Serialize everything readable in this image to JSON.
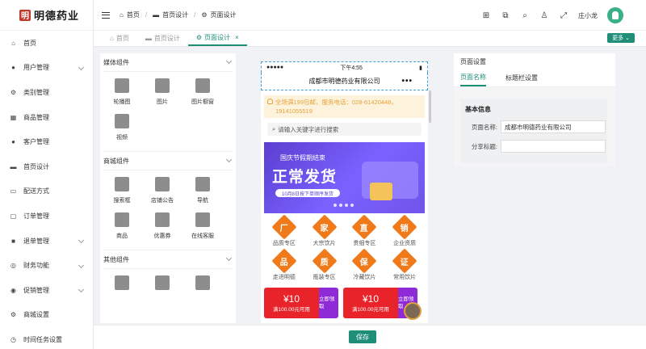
{
  "brand": {
    "name": "明德药业",
    "mark": "明"
  },
  "sidebar": {
    "items": [
      {
        "label": "首页",
        "icon": "home-icon",
        "glyph": "⌂",
        "chevron": false
      },
      {
        "label": "用户管理",
        "icon": "user-icon",
        "glyph": "●",
        "chevron": true
      },
      {
        "label": "类别管理",
        "icon": "category-icon",
        "glyph": "⚙",
        "chevron": false
      },
      {
        "label": "商品管理",
        "icon": "grid-icon",
        "glyph": "▦",
        "chevron": false
      },
      {
        "label": "客户管理",
        "icon": "customer-icon",
        "glyph": "●",
        "chevron": false
      },
      {
        "label": "首页设计",
        "icon": "monitor-icon",
        "glyph": "▬",
        "chevron": false
      },
      {
        "label": "配送方式",
        "icon": "truck-icon",
        "glyph": "▭",
        "chevron": false
      },
      {
        "label": "订单管理",
        "icon": "order-icon",
        "glyph": "▢",
        "chevron": false
      },
      {
        "label": "退单管理",
        "icon": "return-icon",
        "glyph": "■",
        "chevron": true
      },
      {
        "label": "财务功能",
        "icon": "finance-icon",
        "glyph": "◎",
        "chevron": true
      },
      {
        "label": "促销管理",
        "icon": "promo-icon",
        "glyph": "◉",
        "chevron": true
      },
      {
        "label": "商城设置",
        "icon": "shop-settings-icon",
        "glyph": "⚙",
        "chevron": false
      },
      {
        "label": "时间任务设置",
        "icon": "clock-icon",
        "glyph": "◷",
        "chevron": false
      }
    ]
  },
  "header": {
    "breadcrumb": [
      "首页",
      "首页设计",
      "页面设计"
    ],
    "user_name": "庄小龙"
  },
  "tabs": {
    "items": [
      {
        "label": "首页",
        "active": false
      },
      {
        "label": "首页设计",
        "active": false
      },
      {
        "label": "页面设计",
        "active": true
      }
    ],
    "more_label": "更多"
  },
  "components": {
    "sections": [
      {
        "title": "媒体组件",
        "items": [
          "轮播图",
          "图片",
          "图片橱窗",
          "视频"
        ]
      },
      {
        "title": "商城组件",
        "items": [
          "搜索框",
          "店铺公告",
          "导航",
          "商品",
          "优惠券",
          "在线客服"
        ]
      },
      {
        "title": "其他组件",
        "items": [
          "",
          "",
          ""
        ]
      }
    ]
  },
  "phone": {
    "status_dots": "●●●●●",
    "time": "下午4:55",
    "battery": "▮",
    "title": "成都市明德药业有限公司",
    "menu_dots": "•••",
    "notice": "全场满199包邮，服务电话：028-61420448，19141055519",
    "search_placeholder": "请输入关键字进行搜索",
    "banner": {
      "small": "国庆节假期结束",
      "big": "正常发货",
      "note": "10月8日按下单顺序发货"
    },
    "nav_icons": [
      {
        "char": "厂",
        "label": "品质专区"
      },
      {
        "char": "家",
        "label": "大宗饮片"
      },
      {
        "char": "直",
        "label": "贵细专区"
      },
      {
        "char": "销",
        "label": "企业资质"
      },
      {
        "char": "品",
        "label": "走进明德"
      },
      {
        "char": "质",
        "label": "瓶装专区"
      },
      {
        "char": "保",
        "label": "冷藏饮片"
      },
      {
        "char": "证",
        "label": "常用饮片"
      }
    ],
    "coupons": [
      {
        "amount": "¥10",
        "cond": "满100.00元可用",
        "action": "立即领取"
      },
      {
        "amount": "¥10",
        "cond": "满100.00元可用",
        "action": "立即领取"
      }
    ]
  },
  "settings": {
    "title": "页面设置",
    "tabs": [
      "页面名称",
      "标题栏设置"
    ],
    "section": "基本信息",
    "page_name_label": "页面名称:",
    "page_name_value": "成都市明德药业有限公司",
    "share_label": "分享标题:",
    "share_value": ""
  },
  "footer": {
    "save_label": "保存"
  },
  "colors": {
    "accent": "#1f8d78",
    "orange": "#f07a1a",
    "coupon_red": "#e8232a",
    "coupon_purple": "#8f2bd6"
  }
}
